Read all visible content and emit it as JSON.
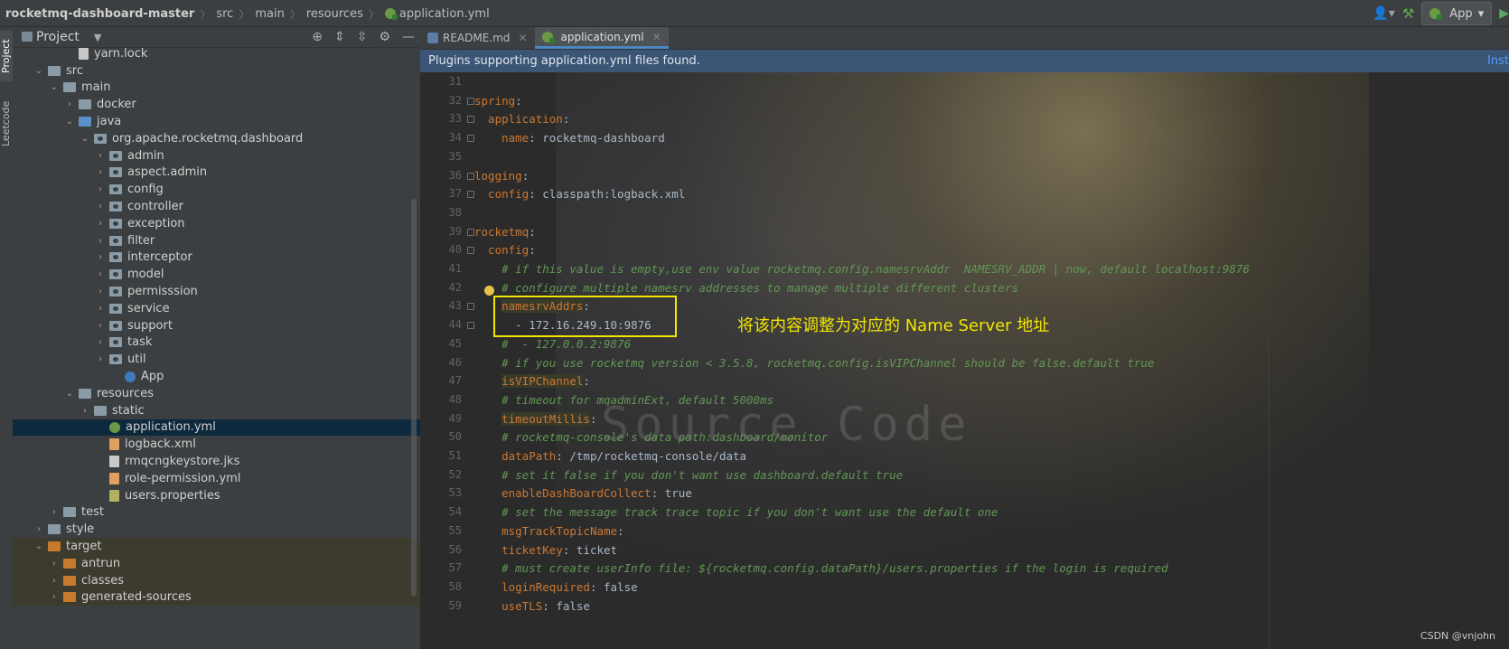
{
  "breadcrumbs": [
    "rocketmq-dashboard-master",
    "src",
    "main",
    "resources",
    "application.yml"
  ],
  "toolbar": {
    "run_config": "App"
  },
  "toolstrip": {
    "project": "Project",
    "leetcode": "Leetcode"
  },
  "project_panel": {
    "title": "Project"
  },
  "tree": [
    {
      "label": "yarn.lock",
      "indent": 3,
      "kind": "file",
      "arrow": ""
    },
    {
      "label": "src",
      "indent": 1,
      "kind": "folder",
      "arrow": "open"
    },
    {
      "label": "main",
      "indent": 2,
      "kind": "folder",
      "arrow": "open"
    },
    {
      "label": "docker",
      "indent": 3,
      "kind": "folder",
      "arrow": "closed"
    },
    {
      "label": "java",
      "indent": 3,
      "kind": "folder-blue",
      "arrow": "open"
    },
    {
      "label": "org.apache.rocketmq.dashboard",
      "indent": 4,
      "kind": "pkg",
      "arrow": "open"
    },
    {
      "label": "admin",
      "indent": 5,
      "kind": "pkg",
      "arrow": "closed"
    },
    {
      "label": "aspect.admin",
      "indent": 5,
      "kind": "pkg",
      "arrow": "closed"
    },
    {
      "label": "config",
      "indent": 5,
      "kind": "pkg",
      "arrow": "closed"
    },
    {
      "label": "controller",
      "indent": 5,
      "kind": "pkg",
      "arrow": "closed"
    },
    {
      "label": "exception",
      "indent": 5,
      "kind": "pkg",
      "arrow": "closed"
    },
    {
      "label": "filter",
      "indent": 5,
      "kind": "pkg",
      "arrow": "closed"
    },
    {
      "label": "interceptor",
      "indent": 5,
      "kind": "pkg",
      "arrow": "closed"
    },
    {
      "label": "model",
      "indent": 5,
      "kind": "pkg",
      "arrow": "closed"
    },
    {
      "label": "permisssion",
      "indent": 5,
      "kind": "pkg",
      "arrow": "closed"
    },
    {
      "label": "service",
      "indent": 5,
      "kind": "pkg",
      "arrow": "closed"
    },
    {
      "label": "support",
      "indent": 5,
      "kind": "pkg",
      "arrow": "closed"
    },
    {
      "label": "task",
      "indent": 5,
      "kind": "pkg",
      "arrow": "closed"
    },
    {
      "label": "util",
      "indent": 5,
      "kind": "pkg",
      "arrow": "closed"
    },
    {
      "label": "App",
      "indent": 6,
      "kind": "app",
      "arrow": ""
    },
    {
      "label": "resources",
      "indent": 3,
      "kind": "folder",
      "arrow": "open"
    },
    {
      "label": "static",
      "indent": 4,
      "kind": "folder",
      "arrow": "closed"
    },
    {
      "label": "application.yml",
      "indent": 5,
      "kind": "yml",
      "arrow": "",
      "selected": true
    },
    {
      "label": "logback.xml",
      "indent": 5,
      "kind": "xml",
      "arrow": ""
    },
    {
      "label": "rmqcngkeystore.jks",
      "indent": 5,
      "kind": "file",
      "arrow": ""
    },
    {
      "label": "role-permission.yml",
      "indent": 5,
      "kind": "xml",
      "arrow": ""
    },
    {
      "label": "users.properties",
      "indent": 5,
      "kind": "props",
      "arrow": ""
    },
    {
      "label": "test",
      "indent": 2,
      "kind": "folder",
      "arrow": "closed"
    },
    {
      "label": "style",
      "indent": 1,
      "kind": "folder",
      "arrow": "closed"
    },
    {
      "label": "target",
      "indent": 1,
      "kind": "folder-orange",
      "arrow": "open",
      "target": true
    },
    {
      "label": "antrun",
      "indent": 2,
      "kind": "folder-orange",
      "arrow": "closed",
      "target": true
    },
    {
      "label": "classes",
      "indent": 2,
      "kind": "folder-orange",
      "arrow": "closed",
      "target": true
    },
    {
      "label": "generated-sources",
      "indent": 2,
      "kind": "folder-orange",
      "arrow": "closed",
      "target": true
    }
  ],
  "tabs": [
    {
      "label": "README.md",
      "icon": "md",
      "active": false
    },
    {
      "label": "application.yml",
      "icon": "yml",
      "active": true
    }
  ],
  "banner": {
    "text": "Plugins supporting application.yml files found.",
    "link": "Inst"
  },
  "code": [
    {
      "n": "31",
      "parts": []
    },
    {
      "n": "32",
      "fold": true,
      "parts": [
        {
          "t": "spring",
          "c": "key"
        },
        {
          "t": ":",
          "c": "val"
        }
      ]
    },
    {
      "n": "33",
      "fold": true,
      "parts": [
        {
          "t": "  application",
          "c": "key"
        },
        {
          "t": ":",
          "c": "val"
        }
      ]
    },
    {
      "n": "34",
      "fold": true,
      "parts": [
        {
          "t": "    name",
          "c": "key"
        },
        {
          "t": ": rocketmq-dashboard",
          "c": "val"
        }
      ]
    },
    {
      "n": "35",
      "parts": []
    },
    {
      "n": "36",
      "fold": true,
      "parts": [
        {
          "t": "logging",
          "c": "key"
        },
        {
          "t": ":",
          "c": "val"
        }
      ]
    },
    {
      "n": "37",
      "fold": true,
      "parts": [
        {
          "t": "  config",
          "c": "key"
        },
        {
          "t": ": classpath:logback.xml",
          "c": "val"
        }
      ]
    },
    {
      "n": "38",
      "parts": []
    },
    {
      "n": "39",
      "fold": true,
      "parts": [
        {
          "t": "rocketmq",
          "c": "key"
        },
        {
          "t": ":",
          "c": "val"
        }
      ]
    },
    {
      "n": "40",
      "fold": true,
      "parts": [
        {
          "t": "  config",
          "c": "key"
        },
        {
          "t": ":",
          "c": "val"
        }
      ]
    },
    {
      "n": "41",
      "parts": [
        {
          "t": "    # if this value is empty,use env value rocketmq.config.namesrvAddr  NAMESRV_ADDR | now, default localhost:9876",
          "c": "cmt"
        }
      ]
    },
    {
      "n": "42",
      "parts": [
        {
          "t": "    # configure multiple namesrv addresses to manage multiple different clusters",
          "c": "cmt"
        }
      ]
    },
    {
      "n": "43",
      "fold": true,
      "parts": [
        {
          "t": "    ",
          "c": "val"
        },
        {
          "t": "namesrvAddrs",
          "c": "hl-key"
        },
        {
          "t": ":",
          "c": "val"
        }
      ]
    },
    {
      "n": "44",
      "fold": true,
      "parts": [
        {
          "t": "      - 172.16.249.10:9876",
          "c": "val"
        }
      ]
    },
    {
      "n": "45",
      "parts": [
        {
          "t": "    #  - 127.0.0.2:9876",
          "c": "cmt"
        }
      ]
    },
    {
      "n": "46",
      "parts": [
        {
          "t": "    # if you use rocketmq version < 3.5.8, rocketmq.config.isVIPChannel should be false.default true",
          "c": "cmt"
        }
      ]
    },
    {
      "n": "47",
      "parts": [
        {
          "t": "    ",
          "c": "val"
        },
        {
          "t": "isVIPChannel",
          "c": "hl-key"
        },
        {
          "t": ":",
          "c": "val"
        }
      ]
    },
    {
      "n": "48",
      "parts": [
        {
          "t": "    # timeout for mqadminExt, default 5000ms",
          "c": "cmt"
        }
      ]
    },
    {
      "n": "49",
      "parts": [
        {
          "t": "    ",
          "c": "val"
        },
        {
          "t": "timeoutMillis",
          "c": "hl-key"
        },
        {
          "t": ":",
          "c": "val"
        }
      ]
    },
    {
      "n": "50",
      "parts": [
        {
          "t": "    # rocketmq-console's data path:dashboard/monitor",
          "c": "cmt"
        }
      ]
    },
    {
      "n": "51",
      "parts": [
        {
          "t": "    ",
          "c": "val"
        },
        {
          "t": "dataPath",
          "c": "key"
        },
        {
          "t": ": /tmp/rocketmq-console/data",
          "c": "val"
        }
      ]
    },
    {
      "n": "52",
      "parts": [
        {
          "t": "    # set it false if you don't want use dashboard.default true",
          "c": "cmt"
        }
      ]
    },
    {
      "n": "53",
      "parts": [
        {
          "t": "    ",
          "c": "val"
        },
        {
          "t": "enableDashBoardCollect",
          "c": "key"
        },
        {
          "t": ": true",
          "c": "val"
        }
      ]
    },
    {
      "n": "54",
      "parts": [
        {
          "t": "    # set the message track trace topic if you don't want use the default one",
          "c": "cmt"
        }
      ]
    },
    {
      "n": "55",
      "parts": [
        {
          "t": "    ",
          "c": "val"
        },
        {
          "t": "msgTrackTopicName",
          "c": "key"
        },
        {
          "t": ":",
          "c": "val"
        }
      ]
    },
    {
      "n": "56",
      "parts": [
        {
          "t": "    ",
          "c": "val"
        },
        {
          "t": "ticketKey",
          "c": "key"
        },
        {
          "t": ": ticket",
          "c": "val"
        }
      ]
    },
    {
      "n": "57",
      "parts": [
        {
          "t": "    # must create userInfo file: ${rocketmq.config.dataPath}/users.properties if the login is required",
          "c": "cmt"
        }
      ]
    },
    {
      "n": "58",
      "parts": [
        {
          "t": "    ",
          "c": "val"
        },
        {
          "t": "loginRequired",
          "c": "key"
        },
        {
          "t": ": false",
          "c": "val"
        }
      ]
    },
    {
      "n": "59",
      "parts": [
        {
          "t": "    ",
          "c": "val"
        },
        {
          "t": "useTLS",
          "c": "key"
        },
        {
          "t": ": false",
          "c": "val"
        }
      ]
    }
  ],
  "watermark": "Source Code",
  "annotation": "将该内容调整为对应的 Name Server 地址",
  "credit": "CSDN @vnjohn"
}
